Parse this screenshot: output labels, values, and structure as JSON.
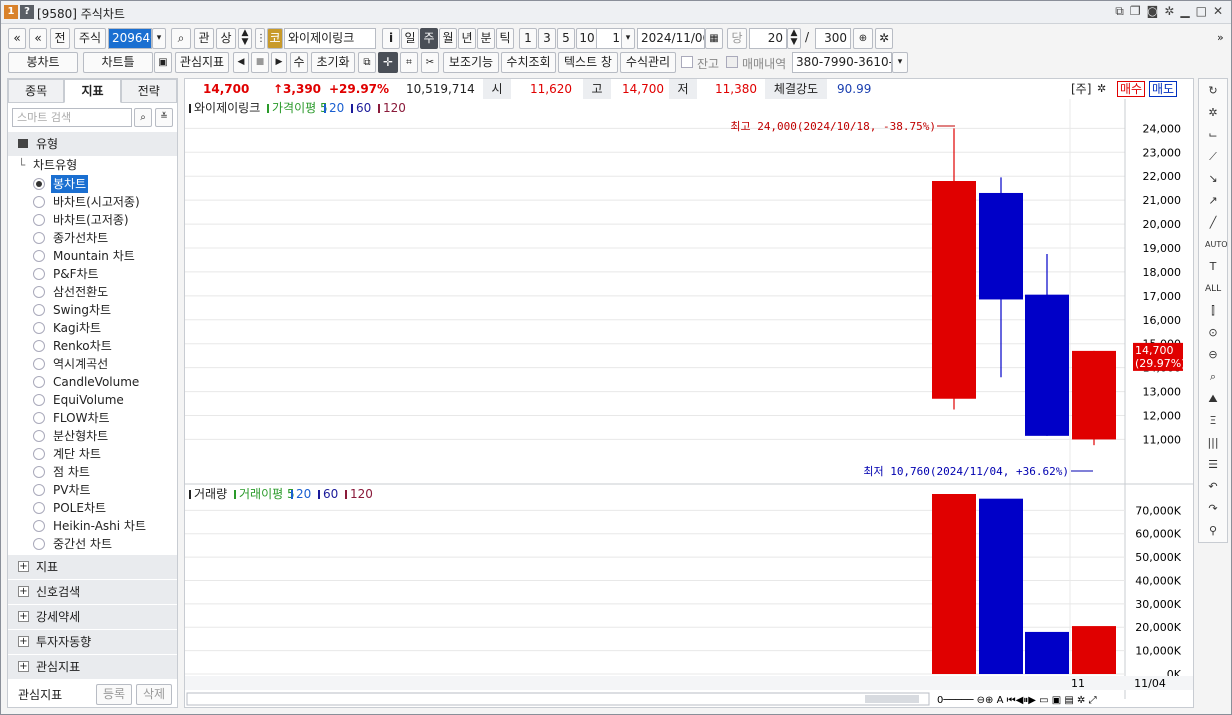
{
  "window": {
    "screen_no": "[9580]",
    "title": "주식차트",
    "badge1": "1",
    "badge2": "?"
  },
  "toolbar1": {
    "nav_prev": "«",
    "nav_up": "«",
    "btn_jeon": "전",
    "market": "주식",
    "code": "209640",
    "search_icon": "⌕",
    "btn_gwan": "관",
    "btn_sang": "상",
    "stock_badge": "코",
    "stock_name": "와이제이링크",
    "btn_info": "i",
    "periods": [
      "일",
      "주",
      "월",
      "년",
      "분",
      "틱"
    ],
    "period_active": "주",
    "units": [
      "1",
      "3",
      "5",
      "10"
    ],
    "unit_value": "1",
    "date": "2024/11/06",
    "btn_dang": "당",
    "count": "20",
    "slash": "/",
    "total": "300"
  },
  "toolbar2": {
    "chart_type": "봉차트",
    "chart_template": "차트틀",
    "indicator": "관심지표",
    "btn_su": "수",
    "btn_reset": "초기화",
    "btn_aux": "보조기능",
    "btn_value": "수치조회",
    "btn_text": "텍스트 창",
    "btn_formula": "수식관리",
    "chk_balance": "잔고",
    "chk_trade": "매매내역",
    "account": "380-7990-3610-1"
  },
  "left": {
    "tabs": [
      "종목",
      "지표",
      "전략"
    ],
    "active_tab": "지표",
    "search_placeholder": "스마트 검색",
    "section_type": "유형",
    "chart_type_group": "차트유형",
    "chart_types": [
      "봉차트",
      "바차트(시고저종)",
      "바차트(고저종)",
      "종가선차트",
      "Mountain 차트",
      "P&F차트",
      "삼선전환도",
      "Swing차트",
      "Kagi차트",
      "Renko차트",
      "역시계곡선",
      "CandleVolume",
      "EquiVolume",
      "FLOW차트",
      "분산형차트",
      "계단 차트",
      "점 차트",
      "PV차트",
      "POLE차트",
      "Heikin-Ashi 차트",
      "중간선 차트"
    ],
    "selected_type": "봉차트",
    "sections": [
      "지표",
      "신호검색",
      "강세약세",
      "투자자동향",
      "관심지표"
    ],
    "footer_label": "관심지표",
    "btn_register": "등록",
    "btn_delete": "삭제"
  },
  "info": {
    "price": "14,700",
    "change": "↑3,390",
    "change_pct": "+29.97%",
    "volume": "10,519,714",
    "open_label": "시",
    "open": "11,620",
    "high_label": "고",
    "high": "14,700",
    "low_label": "저",
    "low": "11,380",
    "strength_label": "체결강도",
    "strength": "90.99",
    "period_tag": "[주]",
    "btn_buy": "매수",
    "btn_sell": "매도"
  },
  "price_legend": {
    "name": "와이제이링크",
    "ma": "가격이평",
    "ma1": "5",
    "ma2": "20",
    "ma3": "60",
    "ma4": "120"
  },
  "volume_legend": {
    "name": "거래량",
    "ma": "거래이평",
    "ma1": "5",
    "ma2": "20",
    "ma3": "60",
    "ma4": "120"
  },
  "annotations": {
    "high": "최고 24,000(2024/10/18, -38.75%)→",
    "low": "최저 10,760(2024/11/04, +36.62%)→",
    "cur_price": "14,700",
    "cur_pct": "(29.97%)"
  },
  "x_axis": {
    "tick_mid": "11",
    "tick_right": "11/04"
  },
  "colors": {
    "up": "#e00000",
    "down": "#0000c8",
    "accent_sel": "#1a6fd1"
  },
  "chart_data": [
    {
      "type": "candlestick",
      "title": "와이제이링크",
      "ylim": [
        10600,
        24600
      ],
      "y_ticks": [
        11000,
        12000,
        13000,
        14000,
        15000,
        16000,
        17000,
        18000,
        19000,
        20000,
        21000,
        22000,
        23000,
        24000
      ],
      "y_tick_labels": [
        "11,000",
        "12,000",
        "13,000",
        "14,000",
        "15,000",
        "16,000",
        "17,000",
        "18,000",
        "19,000",
        "20,000",
        "21,000",
        "22,000",
        "23,000",
        "24,000"
      ],
      "candles": [
        {
          "open": 12700,
          "high": 24000,
          "low": 12250,
          "close": 21800,
          "dir": "up"
        },
        {
          "open": 21300,
          "high": 21950,
          "low": 13600,
          "close": 16850,
          "dir": "down"
        },
        {
          "open": 17050,
          "high": 18750,
          "low": 11150,
          "close": 11150,
          "dir": "down"
        },
        {
          "open": 11000,
          "high": 14700,
          "low": 10760,
          "close": 14700,
          "dir": "up"
        }
      ]
    },
    {
      "type": "bar",
      "title": "거래량",
      "ylim": [
        0,
        77000
      ],
      "y_ticks": [
        0,
        10000,
        20000,
        30000,
        40000,
        50000,
        60000,
        70000
      ],
      "y_tick_labels": [
        "0K",
        "10,000K",
        "20,000K",
        "30,000K",
        "40,000K",
        "50,000K",
        "60,000K",
        "70,000K"
      ],
      "values": [
        77000,
        75000,
        18000,
        20500
      ],
      "dirs": [
        "up",
        "down",
        "down",
        "up"
      ]
    }
  ]
}
